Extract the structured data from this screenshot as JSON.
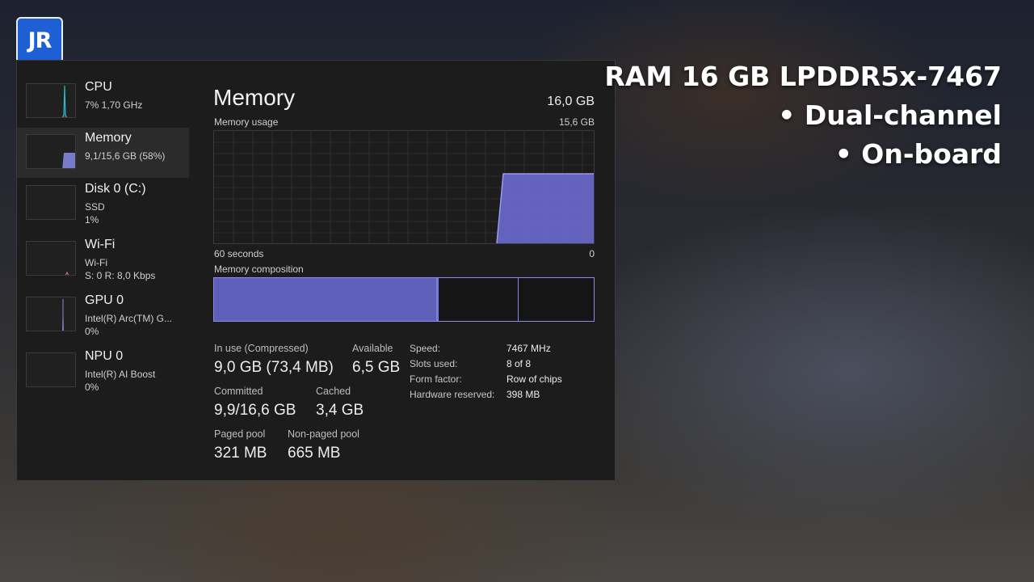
{
  "logo": {
    "text": "JR"
  },
  "sidebar": {
    "items": [
      {
        "title": "CPU",
        "line1": "7% 1,70 GHz",
        "line2": "",
        "color": "#2fb4c9"
      },
      {
        "title": "Memory",
        "line1": "9,1/15,6 GB (58%)",
        "line2": "",
        "color": "#8b8bea"
      },
      {
        "title": "Disk 0 (C:)",
        "line1": "SSD",
        "line2": "1%",
        "color": "#5fb38a"
      },
      {
        "title": "Wi-Fi",
        "line1": "Wi-Fi",
        "line2": "S: 0 R: 8,0 Kbps",
        "color": "#c45fa8"
      },
      {
        "title": "GPU 0",
        "line1": "Intel(R) Arc(TM) G...",
        "line2": "0%",
        "color": "#a080d8"
      },
      {
        "title": "NPU 0",
        "line1": "Intel(R) AI Boost",
        "line2": "0%",
        "color": "#5a8fd6"
      }
    ]
  },
  "main": {
    "title": "Memory",
    "total": "16,0 GB",
    "usage_label": "Memory usage",
    "usage_max": "15,6 GB",
    "axis_left": "60 seconds",
    "axis_right": "0",
    "composition_label": "Memory composition",
    "stats": {
      "in_use_label": "In use (Compressed)",
      "in_use_value": "9,0 GB (73,4 MB)",
      "available_label": "Available",
      "available_value": "6,5 GB",
      "committed_label": "Committed",
      "committed_value": "9,9/16,6 GB",
      "cached_label": "Cached",
      "cached_value": "3,4 GB",
      "paged_label": "Paged pool",
      "paged_value": "321 MB",
      "nonpaged_label": "Non-paged pool",
      "nonpaged_value": "665 MB"
    },
    "specs": [
      {
        "label": "Speed:",
        "value": "7467 MHz"
      },
      {
        "label": "Slots used:",
        "value": "8 of 8"
      },
      {
        "label": "Form factor:",
        "value": "Row of chips"
      },
      {
        "label": "Hardware reserved:",
        "value": "398 MB"
      }
    ],
    "accent": "#8b8bea"
  },
  "overlay": {
    "line1": "RAM 16 GB LPDDR5x-7467",
    "line2": "• Dual-channel",
    "line3": "• On-board"
  }
}
